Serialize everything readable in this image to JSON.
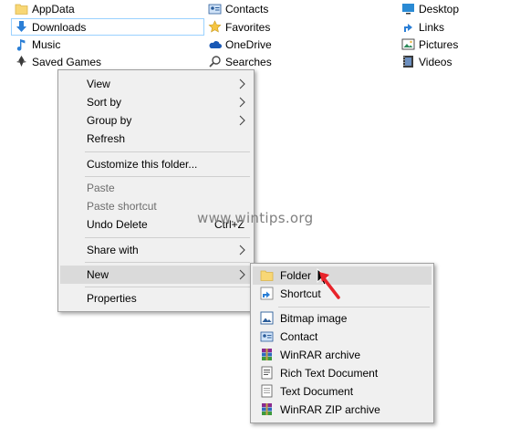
{
  "folder_items": {
    "col1": [
      {
        "label": "AppData",
        "icon": "folder-icon"
      },
      {
        "label": "Downloads",
        "icon": "downloads-icon",
        "selected": true
      },
      {
        "label": "Music",
        "icon": "music-icon"
      },
      {
        "label": "Saved Games",
        "icon": "saved-games-icon"
      }
    ],
    "col2": [
      {
        "label": "Contacts",
        "icon": "contacts-icon"
      },
      {
        "label": "Favorites",
        "icon": "favorites-icon"
      },
      {
        "label": "OneDrive",
        "icon": "onedrive-icon"
      },
      {
        "label": "Searches",
        "icon": "searches-icon"
      }
    ],
    "col3": [
      {
        "label": "Desktop",
        "icon": "desktop-icon"
      },
      {
        "label": "Links",
        "icon": "links-icon"
      },
      {
        "label": "Pictures",
        "icon": "pictures-icon"
      },
      {
        "label": "Videos",
        "icon": "videos-icon"
      }
    ]
  },
  "context_menu": {
    "view": "View",
    "sort_by": "Sort by",
    "group_by": "Group by",
    "refresh": "Refresh",
    "customize": "Customize this folder...",
    "paste": "Paste",
    "paste_shortcut": "Paste shortcut",
    "undo_delete": "Undo Delete",
    "undo_shortcut": "Ctrl+Z",
    "share_with": "Share with",
    "new": "New",
    "properties": "Properties"
  },
  "new_submenu": {
    "folder": "Folder",
    "shortcut": "Shortcut",
    "bitmap": "Bitmap image",
    "contact": "Contact",
    "winrar": "WinRAR archive",
    "rtf": "Rich Text Document",
    "text": "Text Document",
    "winrar_zip": "WinRAR ZIP archive"
  },
  "watermark": "www.wintips.org",
  "colors": {
    "menu_bg": "#f0f0f0",
    "menu_hover": "#dadada",
    "selection_border": "#99d1ff",
    "pointer_red": "#e8232a",
    "folder_yellow": "#f8d775"
  }
}
